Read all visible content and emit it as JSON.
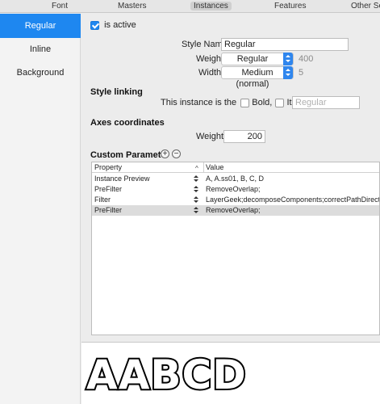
{
  "tabs": [
    {
      "label": "Font"
    },
    {
      "label": "Masters"
    },
    {
      "label": "Instances",
      "selected": true
    },
    {
      "label": "Features"
    },
    {
      "label": "Other Setti"
    }
  ],
  "sidebar": {
    "items": [
      {
        "label": "Regular",
        "active": true
      },
      {
        "label": "Inline"
      },
      {
        "label": "Background"
      }
    ]
  },
  "instance": {
    "is_active_label": "is active",
    "is_active": true,
    "style_name_label": "Style Name",
    "style_name_value": "Regular",
    "weight_label": "Weight",
    "weight_value": "Regular",
    "weight_number": "400",
    "width_label": "Width",
    "width_value": "Medium (normal)",
    "width_number": "5"
  },
  "style_linking": {
    "heading": "Style linking",
    "text": "This instance is the",
    "bold_label": "Bold,",
    "italic_label": "Italic of",
    "link_placeholder": "Regular"
  },
  "axes": {
    "heading": "Axes coordinates",
    "weight_label": "Weight",
    "weight_value": "200"
  },
  "custom_parameters": {
    "heading": "Custom Parameter",
    "add_symbol": "+",
    "remove_symbol": "−",
    "columns": {
      "property": "Property",
      "value": "Value"
    },
    "sort_caret": "^",
    "rows": [
      {
        "property": "Instance Preview",
        "value": "A, A.ss01, B, C, D"
      },
      {
        "property": "PreFilter",
        "value": "RemoveOverlap;"
      },
      {
        "property": "Filter",
        "value": "LayerGeek;decomposeComponents;correctPathDirection;"
      },
      {
        "property": "PreFilter",
        "value": "RemoveOverlap;",
        "selected": true
      }
    ]
  },
  "preview": {
    "text": "AABCD"
  },
  "colors": {
    "accent": "#1e87f0",
    "selected_row": "#dcdcdc"
  }
}
